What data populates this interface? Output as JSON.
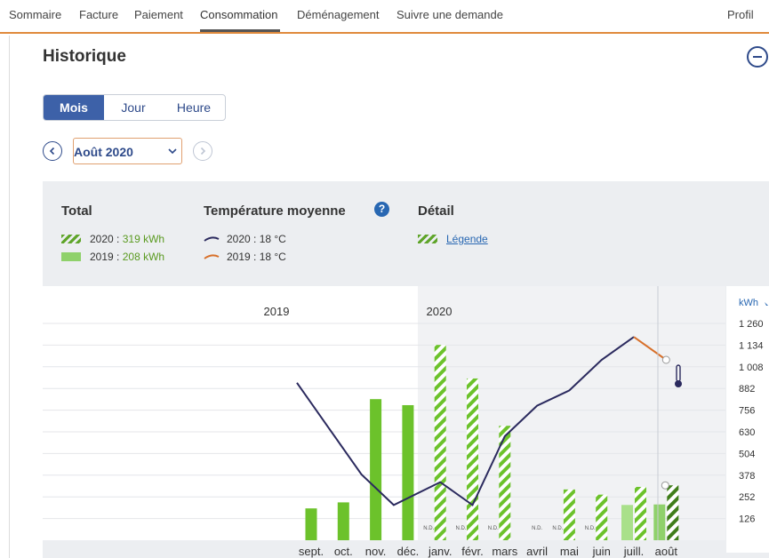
{
  "nav": {
    "items": [
      "Sommaire",
      "Facture",
      "Paiement",
      "Consommation",
      "Déménagement",
      "Suivre une demande"
    ],
    "active": "Consommation",
    "profile": "Profil"
  },
  "page": {
    "title": "Historique"
  },
  "period_tabs": {
    "items": [
      "Mois",
      "Jour",
      "Heure"
    ],
    "active": "Mois"
  },
  "month_select": {
    "value": "Août 2020"
  },
  "summary": {
    "total_heading": "Total",
    "total_2020_label": "2020 :",
    "total_2020_value": "319 kWh",
    "total_2019_label": "2019 :",
    "total_2019_value": "208 kWh",
    "temp_heading": "Température moyenne",
    "temp_2020": "2020 : 18 °C",
    "temp_2019": "2019 : 18 °C",
    "detail_heading": "Détail",
    "legend_link": "Légende"
  },
  "colors": {
    "accent": "#3d61a8",
    "nav_border": "#e08a3c",
    "bar_2019": "#6cc22b",
    "bar_2019_light": "#a9e08a",
    "hatch_2020": "#6cc22b",
    "temp_line_2020": "#2b2a5e",
    "temp_line_2019": "#d8702a"
  },
  "chart_data": {
    "type": "bar",
    "year_labels": [
      "2019",
      "2020"
    ],
    "y_unit": "kWh",
    "y_ticks": [
      126,
      252,
      378,
      504,
      630,
      756,
      882,
      1008,
      1134,
      1260
    ],
    "ylim": [
      0,
      1260
    ],
    "categories": [
      "sept.",
      "oct.",
      "nov.",
      "déc.",
      "janv.",
      "févr.",
      "mars",
      "avril",
      "mai",
      "juin",
      "juill.",
      "août"
    ],
    "na_label": "N.D.",
    "series": [
      {
        "name": "2019",
        "values": [
          185,
          220,
          820,
          785,
          null,
          null,
          null,
          null,
          null,
          null,
          205,
          208
        ]
      },
      {
        "name": "2020",
        "values": [
          null,
          null,
          null,
          null,
          1135,
          940,
          665,
          null,
          295,
          265,
          310,
          319
        ],
        "style": "hatched"
      }
    ],
    "not_available": {
      "2020": [
        "sept.",
        "oct.",
        "nov.",
        "déc."
      ],
      "2019": [
        "janv.",
        "févr.",
        "mars",
        "avril",
        "mai",
        "juin"
      ]
    },
    "temperature_2020": [
      null,
      null,
      null,
      null,
      2,
      -1,
      8,
      12,
      14,
      18,
      21,
      18
    ],
    "temperature_2019": [
      15,
      9,
      3,
      -1,
      null,
      null,
      null,
      null,
      null,
      null,
      19,
      18
    ]
  }
}
